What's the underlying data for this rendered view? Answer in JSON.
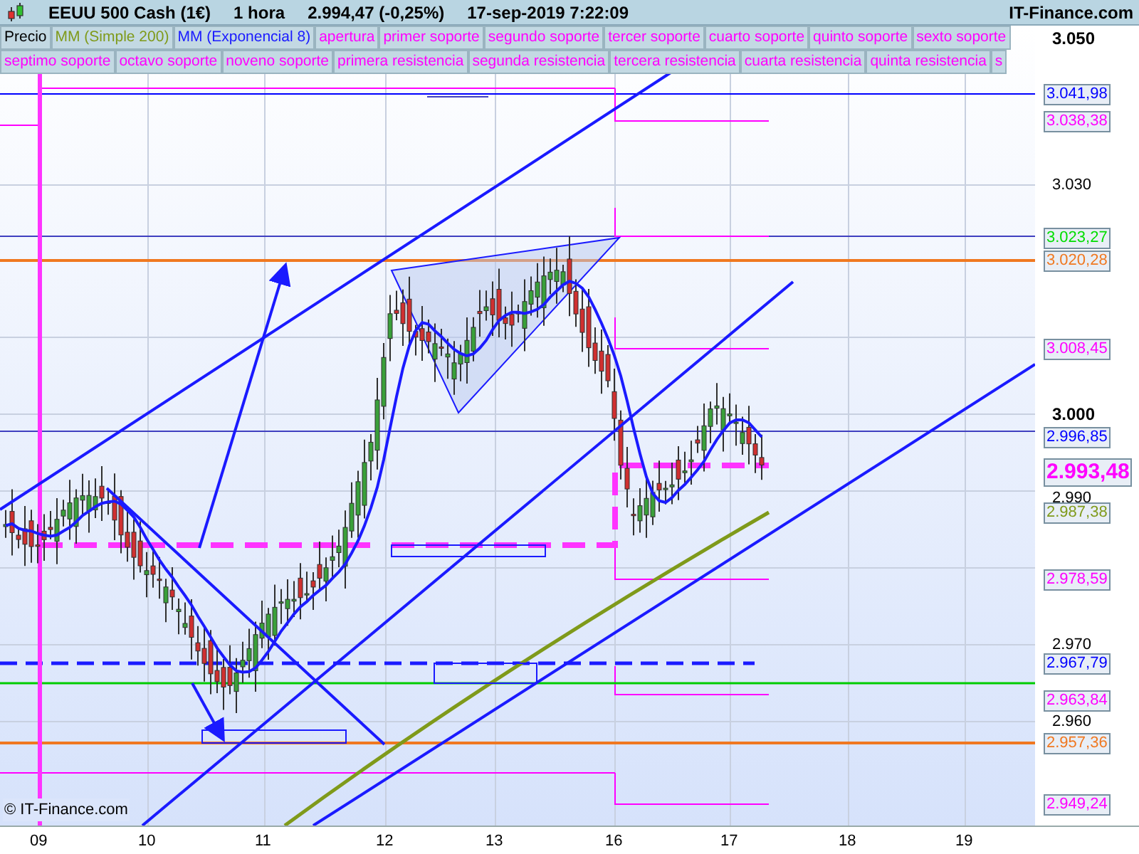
{
  "header": {
    "title": "EEUU 500 Cash (1€)",
    "timeframe": "1 hora",
    "quote": "2.994,47 (-0,25%)",
    "datetime": "17-sep-2019 7:22:09",
    "brand": "IT-Finance.com"
  },
  "legend": {
    "items": [
      {
        "label": "Precio",
        "color": "#000000"
      },
      {
        "label": "MM (Simple 200)",
        "color": "#7f9a1a"
      },
      {
        "label": "MM (Exponencial 8)",
        "color": "#1a1aff"
      },
      {
        "label": "apertura",
        "color": "#ff00ff"
      },
      {
        "label": "primer soporte",
        "color": "#ff00ff"
      },
      {
        "label": "segundo soporte",
        "color": "#ff00ff"
      },
      {
        "label": "tercer soporte",
        "color": "#ff00ff"
      },
      {
        "label": "cuarto soporte",
        "color": "#ff00ff"
      },
      {
        "label": "quinto soporte",
        "color": "#ff00ff"
      },
      {
        "label": "sexto soporte",
        "color": "#ff00ff"
      },
      {
        "label": "septimo soporte",
        "color": "#ff00ff"
      },
      {
        "label": "octavo soporte",
        "color": "#ff00ff"
      },
      {
        "label": "noveno soporte",
        "color": "#ff00ff"
      },
      {
        "label": "primera resistencia",
        "color": "#ff00ff"
      },
      {
        "label": "segunda resistencia",
        "color": "#ff00ff"
      },
      {
        "label": "tercera resistencia",
        "color": "#ff00ff"
      },
      {
        "label": "cuarta resistencia",
        "color": "#ff00ff"
      },
      {
        "label": "quinta resistencia",
        "color": "#ff00ff"
      },
      {
        "label": "s",
        "color": "#ff00ff"
      }
    ]
  },
  "chart": {
    "watermark": "© IT-Finance.com"
  },
  "price_axis": {
    "ticks": [
      {
        "label": "3.050",
        "kind": "major"
      },
      {
        "label": "3.030",
        "kind": "minor"
      },
      {
        "label": "3.000",
        "kind": "major"
      },
      {
        "label": "2.990",
        "kind": "minor"
      },
      {
        "label": "2.970",
        "kind": "minor"
      },
      {
        "label": "2.960",
        "kind": "minor"
      }
    ],
    "tags": [
      {
        "value": "3.041,98",
        "color": "#0000ff",
        "kind": "level"
      },
      {
        "value": "3.038,38",
        "color": "#ff00ff",
        "kind": "level"
      },
      {
        "value": "3.023,27",
        "color": "#00dd00",
        "kind": "level"
      },
      {
        "value": "3.020,28",
        "color": "#f07820",
        "kind": "level"
      },
      {
        "value": "3.008,45",
        "color": "#ff00ff",
        "kind": "level"
      },
      {
        "value": "2.996,85",
        "color": "#0000ff",
        "kind": "level"
      },
      {
        "value": "2.993,48",
        "color": "#ff00ff",
        "kind": "current"
      },
      {
        "value": "2.987,38",
        "color": "#7f9a1a",
        "kind": "level"
      },
      {
        "value": "2.978,59",
        "color": "#ff00ff",
        "kind": "level"
      },
      {
        "value": "2.967,79",
        "color": "#0000ff",
        "kind": "level"
      },
      {
        "value": "2.963,84",
        "color": "#ff00ff",
        "kind": "level"
      },
      {
        "value": "2.957,36",
        "color": "#f07820",
        "kind": "level"
      },
      {
        "value": "2.949,24",
        "color": "#ff00ff",
        "kind": "level"
      }
    ]
  },
  "date_axis": {
    "labels": [
      "09",
      "10",
      "11",
      "12",
      "13",
      "16",
      "17",
      "18",
      "19"
    ]
  }
}
